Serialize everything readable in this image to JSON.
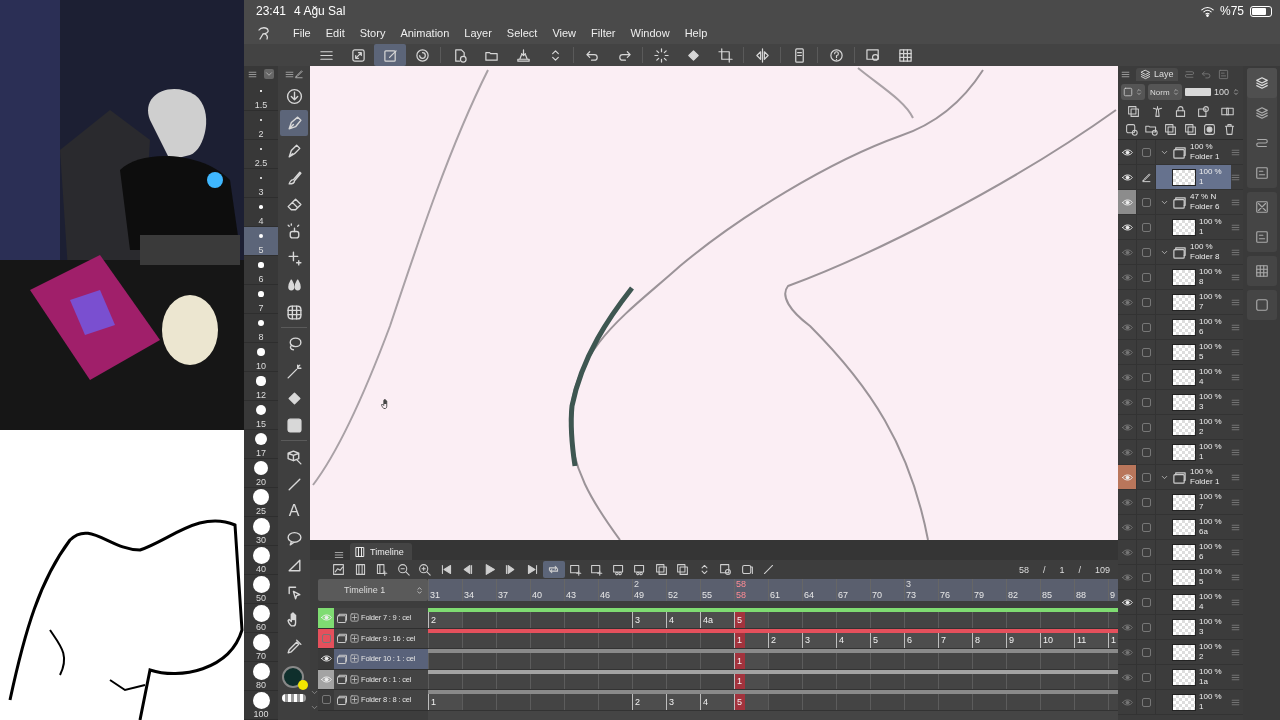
{
  "status_bar": {
    "time": "23:41",
    "date": "4 Ağu Sal",
    "battery": "%75"
  },
  "menu": [
    "File",
    "Edit",
    "Story",
    "Animation",
    "Layer",
    "Select",
    "View",
    "Filter",
    "Window",
    "Help"
  ],
  "toolbar": {
    "groups": [
      [
        {
          "kind": "menu",
          "selected": false
        },
        {
          "kind": "resize",
          "selected": false
        },
        {
          "kind": "pensq",
          "selected": true
        },
        {
          "kind": "swirl",
          "selected": false
        }
      ],
      [
        {
          "kind": "newpage",
          "selected": false
        },
        {
          "kind": "folder",
          "selected": false
        },
        {
          "kind": "tray",
          "selected": false
        },
        {
          "kind": "updown",
          "selected": false
        }
      ],
      [
        {
          "kind": "undo",
          "selected": false
        },
        {
          "kind": "redo",
          "selected": false
        }
      ],
      [
        {
          "kind": "spinner",
          "selected": false
        },
        {
          "kind": "bucket",
          "selected": false
        },
        {
          "kind": "crop",
          "selected": false
        }
      ],
      [
        {
          "kind": "flip",
          "selected": false
        }
      ],
      [
        {
          "kind": "tablet",
          "selected": false
        }
      ],
      [
        {
          "kind": "help",
          "selected": false
        }
      ],
      [
        {
          "kind": "screen",
          "selected": false
        },
        {
          "kind": "grid",
          "selected": false
        }
      ]
    ]
  },
  "brush_sizes": [
    {
      "label": "1.5",
      "selected": false
    },
    {
      "label": "2",
      "selected": false
    },
    {
      "label": "2.5",
      "selected": false
    },
    {
      "label": "3",
      "selected": false
    },
    {
      "label": "4",
      "selected": false
    },
    {
      "label": "5",
      "selected": true
    },
    {
      "label": "6",
      "selected": false
    },
    {
      "label": "7",
      "selected": false
    },
    {
      "label": "8",
      "selected": false
    },
    {
      "label": "10",
      "selected": false
    },
    {
      "label": "12",
      "selected": false
    },
    {
      "label": "15",
      "selected": false
    },
    {
      "label": "17",
      "selected": false
    },
    {
      "label": "20",
      "selected": false
    },
    {
      "label": "25",
      "selected": false
    },
    {
      "label": "30",
      "selected": false
    },
    {
      "label": "40",
      "selected": false
    },
    {
      "label": "50",
      "selected": false
    },
    {
      "label": "60",
      "selected": false
    },
    {
      "label": "70",
      "selected": false
    },
    {
      "label": "80",
      "selected": false
    },
    {
      "label": "100",
      "selected": false
    }
  ],
  "tools": {
    "groups": [
      [
        {
          "kind": "download",
          "selected": false
        },
        {
          "kind": "pen",
          "selected": true
        },
        {
          "kind": "nib",
          "selected": false
        },
        {
          "kind": "brush",
          "selected": false
        },
        {
          "kind": "eraser",
          "selected": false
        },
        {
          "kind": "airbrush",
          "selected": false
        },
        {
          "kind": "sparkle",
          "selected": false
        },
        {
          "kind": "drops",
          "selected": false
        },
        {
          "kind": "mesh",
          "selected": false
        }
      ],
      [
        {
          "kind": "lasso",
          "selected": false
        },
        {
          "kind": "wand",
          "selected": false
        },
        {
          "kind": "bucket",
          "selected": false
        },
        {
          "kind": "gradient",
          "selected": false
        }
      ],
      [
        {
          "kind": "cube",
          "selected": false
        },
        {
          "kind": "line",
          "selected": false
        },
        {
          "kind": "text",
          "label": "A",
          "selected": false
        },
        {
          "kind": "balloon",
          "selected": false
        },
        {
          "kind": "triangle",
          "selected": false
        },
        {
          "kind": "cursor",
          "selected": false
        },
        {
          "kind": "hand",
          "selected": false
        },
        {
          "kind": "dropper",
          "selected": false
        }
      ]
    ],
    "colors": [
      {
        "color": "#0f2f2c"
      },
      {
        "color": "#f2e600"
      }
    ]
  },
  "timeline": {
    "tab": "Timeline",
    "name": "Timeline 1",
    "playhead": "58",
    "toolbar": {
      "groups": [
        [
          {
            "kind": "graph",
            "selected": false
          },
          {
            "kind": "film",
            "selected": false
          },
          {
            "kind": "filmadd",
            "selected": false
          }
        ],
        [
          {
            "kind": "zoomout",
            "selected": false
          },
          {
            "kind": "zoomin",
            "selected": false
          }
        ],
        [
          {
            "kind": "first",
            "selected": false
          },
          {
            "kind": "prev",
            "selected": false
          },
          {
            "kind": "play",
            "selected": false
          },
          {
            "kind": "next",
            "selected": false
          },
          {
            "kind": "last",
            "selected": false
          },
          {
            "kind": "loop",
            "selected": true
          }
        ],
        [
          {
            "kind": "celadd",
            "selected": false
          },
          {
            "kind": "celadd",
            "selected": false
          },
          {
            "kind": "cellink",
            "selected": false
          },
          {
            "kind": "cellink",
            "selected": false
          },
          {
            "kind": "copy",
            "selected": false
          }
        ],
        [
          {
            "kind": "copy",
            "selected": false
          },
          {
            "kind": "updown",
            "selected": false
          },
          {
            "kind": "celset",
            "selected": false
          },
          {
            "kind": "onion",
            "selected": false
          },
          {
            "kind": "line",
            "selected": false
          }
        ]
      ]
    },
    "counter": [
      "58",
      "/",
      "1",
      "/",
      "109"
    ],
    "ticks": [
      {
        "label": "31"
      },
      {
        "label": "34"
      },
      {
        "label": "37"
      },
      {
        "label": "40"
      },
      {
        "label": "43"
      },
      {
        "label": "46"
      },
      {
        "label": "49",
        "section": "2"
      },
      {
        "label": "52"
      },
      {
        "label": "55"
      },
      {
        "label": "58",
        "current": true
      },
      {
        "label": "61"
      },
      {
        "label": "64"
      },
      {
        "label": "67"
      },
      {
        "label": "70"
      },
      {
        "label": "73",
        "section": "3"
      },
      {
        "label": "76"
      },
      {
        "label": "79"
      },
      {
        "label": "82"
      },
      {
        "label": "85"
      },
      {
        "label": "88"
      },
      {
        "label": "9"
      }
    ],
    "tracks": [
      {
        "name": "Folder 7 : 9 : cel",
        "visible": true,
        "selected": false,
        "color": "#7fdc72",
        "slots": [
          {
            "label": "2",
            "start": true
          },
          {
            "start": false
          },
          {
            "start": false
          },
          {
            "start": false
          },
          {
            "start": false
          },
          {
            "start": false
          },
          {
            "label": "3",
            "start": true
          },
          {
            "label": "4",
            "start": true
          },
          {
            "label": "4a",
            "start": true
          },
          {
            "label": "5",
            "start": true
          },
          {
            "start": false
          },
          {
            "start": false
          },
          {
            "start": false
          },
          {
            "start": false
          },
          {
            "start": false
          },
          {
            "start": false
          },
          {
            "start": false
          },
          {
            "start": false
          },
          {
            "start": false
          },
          {
            "start": false
          },
          {
            "start": false
          }
        ]
      },
      {
        "name": "Folder 9 : 16 : cel",
        "visible": false,
        "selected": false,
        "color": "#e5505c",
        "slots": [
          {
            "start": false
          },
          {
            "start": false
          },
          {
            "start": false
          },
          {
            "start": false
          },
          {
            "start": false
          },
          {
            "start": false
          },
          {
            "start": false
          },
          {
            "start": false
          },
          {
            "start": false
          },
          {
            "label": "1",
            "start": true
          },
          {
            "label": "2",
            "start": true
          },
          {
            "label": "3",
            "start": true
          },
          {
            "label": "4",
            "start": true
          },
          {
            "label": "5",
            "start": true
          },
          {
            "label": "6",
            "start": true
          },
          {
            "label": "7",
            "start": true
          },
          {
            "label": "8",
            "start": true
          },
          {
            "label": "9",
            "start": true
          },
          {
            "label": "10",
            "start": true
          },
          {
            "label": "11",
            "start": true
          },
          {
            "label": "1",
            "start": true
          }
        ]
      },
      {
        "name": "Folder 10 : 1 : cel",
        "visible": true,
        "selected": true,
        "slots": [
          {
            "start": false
          },
          {
            "start": false
          },
          {
            "start": false
          },
          {
            "start": false
          },
          {
            "start": false
          },
          {
            "start": false
          },
          {
            "start": false
          },
          {
            "start": false
          },
          {
            "start": false
          },
          {
            "label": "1",
            "start": true
          },
          {
            "start": false
          },
          {
            "start": false
          },
          {
            "start": false
          },
          {
            "start": false
          },
          {
            "start": false
          },
          {
            "start": false
          },
          {
            "start": false
          },
          {
            "start": false
          },
          {
            "start": false
          },
          {
            "start": false
          },
          {
            "start": false
          }
        ]
      },
      {
        "name": "Folder 6 : 1 : cel",
        "visible": true,
        "selected": false,
        "color": "#a3a3a3",
        "slots": [
          {
            "start": false
          },
          {
            "start": false
          },
          {
            "start": false
          },
          {
            "start": false
          },
          {
            "start": false
          },
          {
            "start": false
          },
          {
            "start": false
          },
          {
            "start": false
          },
          {
            "start": false
          },
          {
            "label": "1",
            "start": true
          },
          {
            "start": false
          },
          {
            "start": false
          },
          {
            "start": false
          },
          {
            "start": false
          },
          {
            "start": false
          },
          {
            "start": false
          },
          {
            "start": false
          },
          {
            "start": false
          },
          {
            "start": false
          },
          {
            "start": false
          },
          {
            "start": false
          }
        ]
      },
      {
        "name": "Folder 8 : 8 : cel",
        "visible": false,
        "selected": false,
        "slots": [
          {
            "label": "1",
            "start": true
          },
          {
            "start": false
          },
          {
            "start": false
          },
          {
            "start": false
          },
          {
            "start": false
          },
          {
            "start": false
          },
          {
            "label": "2",
            "start": true
          },
          {
            "label": "3",
            "start": true
          },
          {
            "label": "4",
            "start": true
          },
          {
            "label": "5",
            "start": true
          },
          {
            "start": false
          },
          {
            "start": false
          },
          {
            "start": false
          },
          {
            "start": false
          },
          {
            "start": false
          },
          {
            "start": false
          },
          {
            "start": false
          },
          {
            "start": false
          },
          {
            "start": false
          },
          {
            "start": false
          },
          {
            "start": false
          }
        ]
      }
    ]
  },
  "layers": {
    "tab": "Laye",
    "blend_mode": "Norm",
    "opacity": "100",
    "opacity_slider": {
      "level": 1
    },
    "icon_rows": [
      [
        {
          "kind": "copy"
        },
        {
          "kind": "ref"
        },
        {
          "kind": "lock"
        },
        {
          "kind": "maskcol"
        },
        {
          "kind": "clip"
        }
      ],
      [
        {
          "kind": "newlayer"
        },
        {
          "kind": "newfolder"
        },
        {
          "kind": "copy"
        },
        {
          "kind": "copy"
        },
        {
          "kind": "maskdot"
        },
        {
          "kind": "trash"
        }
      ]
    ],
    "items": [
      {
        "kind": "folder",
        "opacity": "100 %",
        "name": "Folder 1",
        "visible": true,
        "selected": false,
        "expanded": true,
        "children": [
          {
            "kind": "layer",
            "opacity": "100 %",
            "name": "1",
            "visible": true,
            "selected": true
          }
        ]
      },
      {
        "kind": "folder",
        "opacity": "47 % N",
        "name": "Folder 6",
        "visible": true,
        "selected": false,
        "expanded": true,
        "color": "#8c8c8c",
        "children": [
          {
            "kind": "layer",
            "opacity": "100 %",
            "name": "1",
            "visible": true,
            "selected": false
          }
        ]
      },
      {
        "kind": "folder",
        "opacity": "100 %",
        "name": "Folder 8",
        "visible": false,
        "selected": false,
        "expanded": true,
        "children": [
          {
            "kind": "layer",
            "opacity": "100 %",
            "name": "8",
            "visible": false,
            "selected": false
          },
          {
            "kind": "layer",
            "opacity": "100 %",
            "name": "7",
            "visible": false,
            "selected": false
          },
          {
            "kind": "layer",
            "opacity": "100 %",
            "name": "6",
            "visible": false,
            "selected": false
          },
          {
            "kind": "layer",
            "opacity": "100 %",
            "name": "5",
            "visible": false,
            "selected": false
          },
          {
            "kind": "layer",
            "opacity": "100 %",
            "name": "4",
            "visible": false,
            "selected": false
          },
          {
            "kind": "layer",
            "opacity": "100 %",
            "name": "3",
            "visible": false,
            "selected": false
          },
          {
            "kind": "layer",
            "opacity": "100 %",
            "name": "2",
            "visible": false,
            "selected": false
          },
          {
            "kind": "layer",
            "opacity": "100 %",
            "name": "1",
            "visible": false,
            "selected": false
          }
        ]
      },
      {
        "kind": "folder",
        "opacity": "100 %",
        "name": "Folder 1",
        "visible": true,
        "selected": false,
        "expanded": true,
        "color": "#b9765b",
        "children": [
          {
            "kind": "layer",
            "opacity": "100 %",
            "name": "7",
            "visible": false,
            "selected": false
          },
          {
            "kind": "layer",
            "opacity": "100 %",
            "name": "6a",
            "visible": false,
            "selected": false
          },
          {
            "kind": "layer",
            "opacity": "100 %",
            "name": "6",
            "visible": false,
            "selected": false
          },
          {
            "kind": "layer",
            "opacity": "100 %",
            "name": "5",
            "visible": false,
            "selected": false
          },
          {
            "kind": "layer",
            "opacity": "100 %",
            "name": "4",
            "visible": true,
            "selected": false
          },
          {
            "kind": "layer",
            "opacity": "100 %",
            "name": "3",
            "visible": false,
            "selected": false
          },
          {
            "kind": "layer",
            "opacity": "100 %",
            "name": "2",
            "visible": false,
            "selected": false
          },
          {
            "kind": "layer",
            "opacity": "100 %",
            "name": "1a",
            "visible": false,
            "selected": false
          },
          {
            "kind": "layer",
            "opacity": "100 %",
            "name": "1",
            "visible": false,
            "selected": false
          }
        ]
      }
    ]
  },
  "side_strip": {
    "groups": [
      [
        {
          "kind": "layers",
          "selected": true
        },
        {
          "kind": "layers",
          "selected": false
        },
        {
          "kind": "route",
          "selected": false
        },
        {
          "kind": "panel",
          "selected": false
        }
      ],
      [
        {
          "kind": "xsquare",
          "selected": false
        },
        {
          "kind": "panel",
          "selected": false
        }
      ],
      [
        {
          "kind": "grid",
          "selected": false
        }
      ],
      [
        {
          "kind": "square",
          "selected": false
        }
      ]
    ]
  }
}
